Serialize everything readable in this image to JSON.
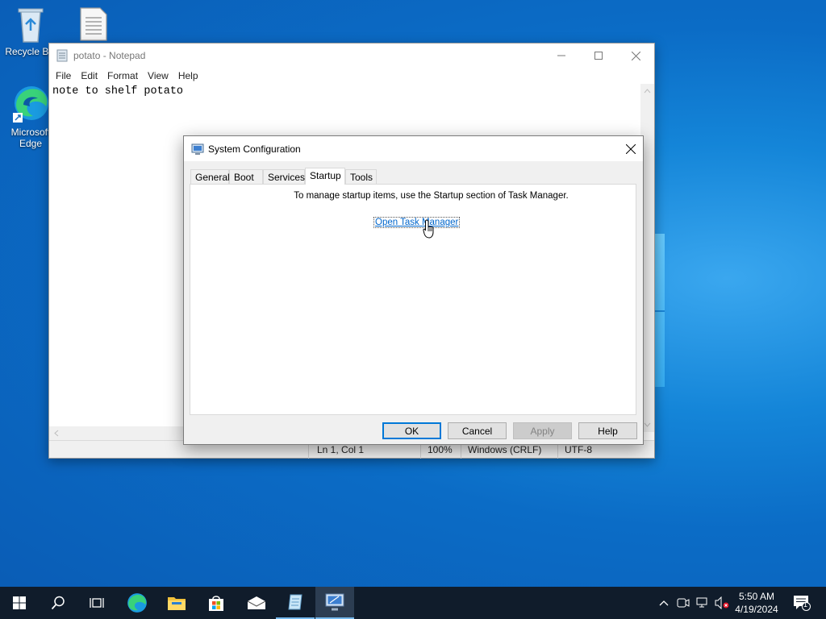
{
  "desktop": {
    "icons": [
      {
        "label": "Recycle Bin",
        "icon": "recycle-bin-icon"
      },
      {
        "label": "",
        "icon": "text-file-icon"
      },
      {
        "label": "Microsoft Edge",
        "icon": "edge-icon"
      }
    ]
  },
  "notepad": {
    "title": "potato - Notepad",
    "menu": [
      "File",
      "Edit",
      "Format",
      "View",
      "Help"
    ],
    "content": "note to shelf potato",
    "status": {
      "position": "Ln 1, Col 1",
      "zoom": "100%",
      "line_ending": "Windows (CRLF)",
      "encoding": "UTF-8"
    }
  },
  "sysconfig": {
    "title": "System Configuration",
    "tabs": [
      "General",
      "Boot",
      "Services",
      "Startup",
      "Tools"
    ],
    "active_tab": "Startup",
    "message": "To manage startup items, use the Startup section of Task Manager.",
    "link": "Open Task Manager",
    "buttons": {
      "ok": "OK",
      "cancel": "Cancel",
      "apply": "Apply",
      "help": "Help"
    }
  },
  "taskbar": {
    "clock_time": "5:50 AM",
    "clock_date": "4/19/2024",
    "notification_count": "1"
  },
  "colors": {
    "accent": "#0078d7",
    "link": "#0066cc",
    "taskbar": "#101c2b"
  }
}
